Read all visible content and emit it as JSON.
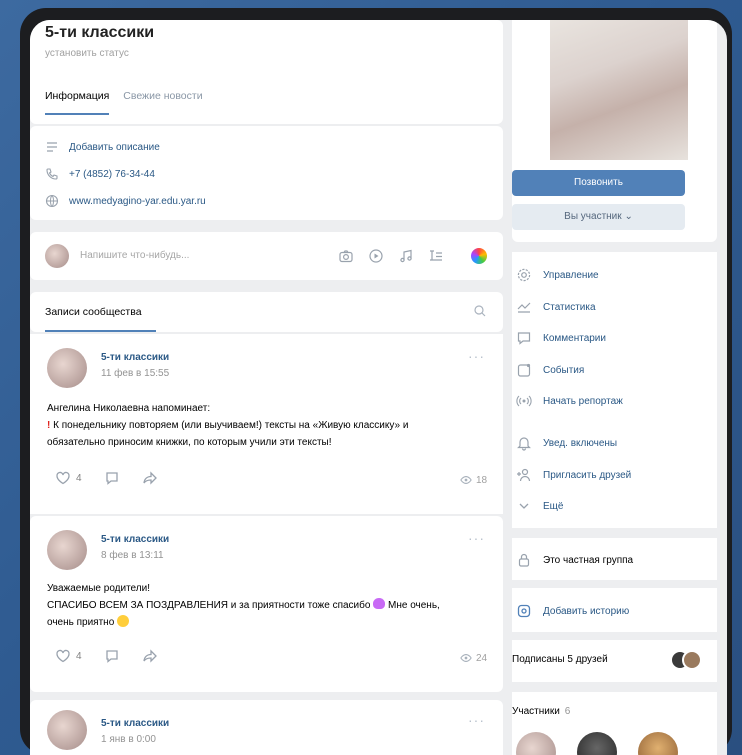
{
  "group": {
    "title": "5-ти классики",
    "status": "установить статус",
    "tabs": [
      "Информация",
      "Свежие новости"
    ]
  },
  "info": {
    "add_description": "Добавить описание",
    "phone": "+7 (4852) 76-34-44",
    "website": "www.medyagino-yar.edu.yar.ru"
  },
  "composer": {
    "placeholder": "Напишите что-нибудь..."
  },
  "posts_header": {
    "title": "Записи сообщества"
  },
  "posts": [
    {
      "author": "5-ти классики",
      "date": "11 фев в 15:55",
      "line1": "Ангелина Николаевна напоминает:",
      "line2": "К понедельнику повторяем (или выучиваем!) тексты на «Живую классику» и",
      "line3": "обязательно приносим книжки, по которым учили эти тексты!",
      "likes": "4",
      "views": "18"
    },
    {
      "author": "5-ти классики",
      "date": "8 фев в 13:11",
      "line1": "Уважаемые родители!",
      "line2": "СПАСИБО ВСЕМ ЗА ПОЗДРАВЛЕНИЯ и за приятности тоже спасибо",
      "line2b": "Мне очень,",
      "line3": "очень приятно",
      "likes": "4",
      "views": "24"
    },
    {
      "author": "5-ти классики",
      "date": "1 янв в 0:00"
    }
  ],
  "right": {
    "call_button": "Позвонить",
    "member_button": "Вы участник",
    "menu": [
      {
        "label": "Управление",
        "icon": "gear-icon"
      },
      {
        "label": "Статистика",
        "icon": "stats-icon"
      },
      {
        "label": "Комментарии",
        "icon": "comment-icon"
      },
      {
        "label": "События",
        "icon": "event-icon"
      },
      {
        "label": "Начать репортаж",
        "icon": "broadcast-icon"
      },
      {
        "label": "Увед. включены",
        "icon": "bell-icon"
      },
      {
        "label": "Пригласить друзей",
        "icon": "add-user-icon"
      },
      {
        "label": "Ещё",
        "icon": "chevron-down-icon"
      }
    ],
    "private_group": "Это частная группа",
    "add_story": "Добавить историю",
    "friends_subscribed": "Подписаны 5 друзей",
    "members_label": "Участники",
    "members_count": "6"
  },
  "colors": {
    "accent": "#5181b8",
    "link": "#2a5885",
    "background": "#edeef0"
  }
}
